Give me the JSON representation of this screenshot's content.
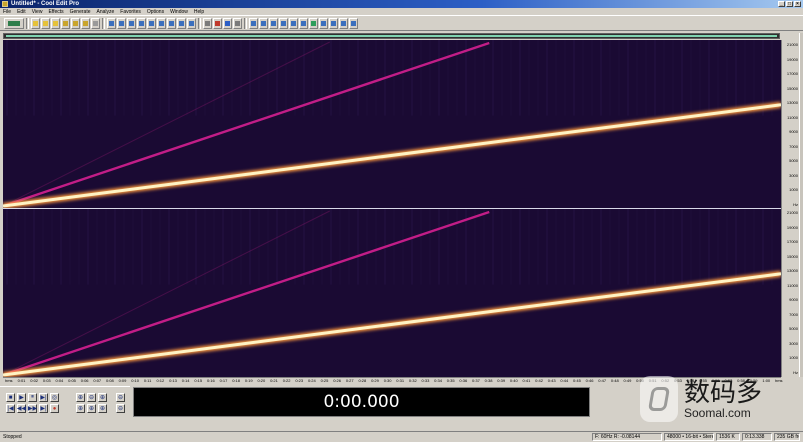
{
  "window": {
    "title": "Untitled* - Cool Edit Pro"
  },
  "menu": [
    "File",
    "Edit",
    "View",
    "Effects",
    "Generate",
    "Analyze",
    "Favorites",
    "Options",
    "Window",
    "Help"
  ],
  "toolbar": {
    "icons": [
      "open-icon",
      "save-icon",
      "new-icon",
      "cut-icon",
      "copy-icon",
      "paste-icon",
      "undo-icon",
      "waveform-icon",
      "spectral-icon",
      "mixer-icon",
      "grid-icon",
      "scan-icon",
      "zoom-icon",
      "snap-icon",
      "settings-icon",
      "metronome-icon",
      "loop-icon",
      "wave-view-icon",
      "spectrum-view-icon"
    ]
  },
  "spectrogram": {
    "channels": [
      "left",
      "right"
    ],
    "colors": {
      "background": "#1a0a33",
      "fundamental": "#fff3c4",
      "harmonic": "#c21d87",
      "grid": "#3a2466"
    },
    "sweep": {
      "fundamental_end_fraction": 0.61,
      "harmonic_end_fraction": 0.985
    }
  },
  "y_ruler": {
    "ticks": [
      "21000",
      "19000",
      "17000",
      "15000",
      "13000",
      "11000",
      "9000",
      "7000",
      "5000",
      "3000",
      "1000",
      "Hz"
    ]
  },
  "x_ruler": {
    "ticks": [
      "hms",
      "0:01",
      "0:02",
      "0:03",
      "0:04",
      "0:05",
      "0:06",
      "0:07",
      "0:08",
      "0:09",
      "0:10",
      "0:11",
      "0:12",
      "0:13",
      "0:14",
      "0:15",
      "0:16",
      "0:17",
      "0:18",
      "0:19",
      "0:20",
      "0:21",
      "0:22",
      "0:23",
      "0:24",
      "0:25",
      "0:26",
      "0:27",
      "0:28",
      "0:29",
      "0:30",
      "0:31",
      "0:32",
      "0:33",
      "0:34",
      "0:35",
      "0:36",
      "0:37",
      "0:38",
      "0:39",
      "0:40",
      "0:41",
      "0:42",
      "0:43",
      "0:44",
      "0:45",
      "0:46",
      "0:47",
      "0:48",
      "0:49",
      "0:50",
      "0:51",
      "0:52",
      "0:53",
      "0:54",
      "0:55",
      "0:56",
      "0:57",
      "0:58",
      "0:59",
      "1:00",
      "hms"
    ]
  },
  "transport": {
    "row1": [
      "■",
      "▶",
      "⏸",
      "▶|",
      "◎"
    ],
    "row2": [
      "|◀",
      "◀◀",
      "▶▶",
      "▶|",
      "●"
    ],
    "zoom_row1": [
      "⊕",
      "⊖",
      "⊕",
      "⊖"
    ],
    "zoom_row2": [
      "⊕",
      "⊕",
      "⊕",
      "⊖"
    ]
  },
  "time_display": "0:00.000",
  "status": {
    "left": "Stopped",
    "cells": [
      "F: 60Hz  R: -0.08144",
      "48000 • 16-bit • Stereo",
      "1536 K",
      "0:13.338",
      "235 GB free"
    ]
  },
  "watermark": {
    "cn": "数码多",
    "en": "Soomal.com"
  }
}
